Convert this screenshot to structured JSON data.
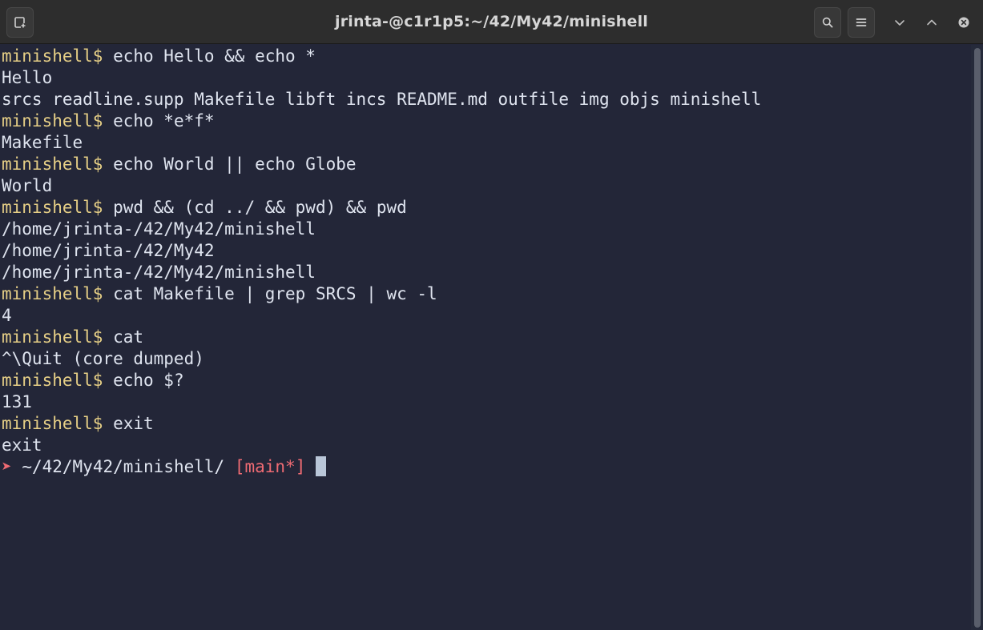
{
  "window": {
    "title": "jrinta-@c1r1p5:~/42/My42/minishell"
  },
  "titlebar_icons": {
    "new_tab": "new-tab-icon",
    "search": "search-icon",
    "menu": "hamburger-menu-icon",
    "minimize": "chevron-down-icon",
    "maximize": "chevron-up-icon",
    "close": "close-icon"
  },
  "colors": {
    "background": "#232638",
    "prompt": "#e6cf86",
    "text": "#dfe4ef",
    "accent_red": "#ef6b73",
    "cursor": "#b9c6d8"
  },
  "terminal": {
    "prompt": "minishell$",
    "lines": [
      {
        "kind": "cmd",
        "text": "echo Hello && echo *"
      },
      {
        "kind": "out",
        "text": "Hello"
      },
      {
        "kind": "out",
        "text": "srcs readline.supp Makefile libft incs README.md outfile img objs minishell"
      },
      {
        "kind": "cmd",
        "text": "echo *e*f*"
      },
      {
        "kind": "out",
        "text": "Makefile"
      },
      {
        "kind": "cmd",
        "text": "echo World || echo Globe"
      },
      {
        "kind": "out",
        "text": "World"
      },
      {
        "kind": "cmd",
        "text": "pwd && (cd ../ && pwd) && pwd"
      },
      {
        "kind": "out",
        "text": "/home/jrinta-/42/My42/minishell"
      },
      {
        "kind": "out",
        "text": "/home/jrinta-/42/My42"
      },
      {
        "kind": "out",
        "text": "/home/jrinta-/42/My42/minishell"
      },
      {
        "kind": "cmd",
        "text": "cat Makefile | grep SRCS | wc -l"
      },
      {
        "kind": "out",
        "text": "4"
      },
      {
        "kind": "cmd",
        "text": "cat"
      },
      {
        "kind": "out",
        "text": "^\\Quit (core dumped)"
      },
      {
        "kind": "cmd",
        "text": "echo $?"
      },
      {
        "kind": "out",
        "text": "131"
      },
      {
        "kind": "cmd",
        "text": "exit"
      },
      {
        "kind": "out",
        "text": "exit"
      }
    ],
    "final_prompt": {
      "arrow": "➤",
      "path": "~/42/My42/minishell/",
      "branch": "[main*]"
    }
  }
}
